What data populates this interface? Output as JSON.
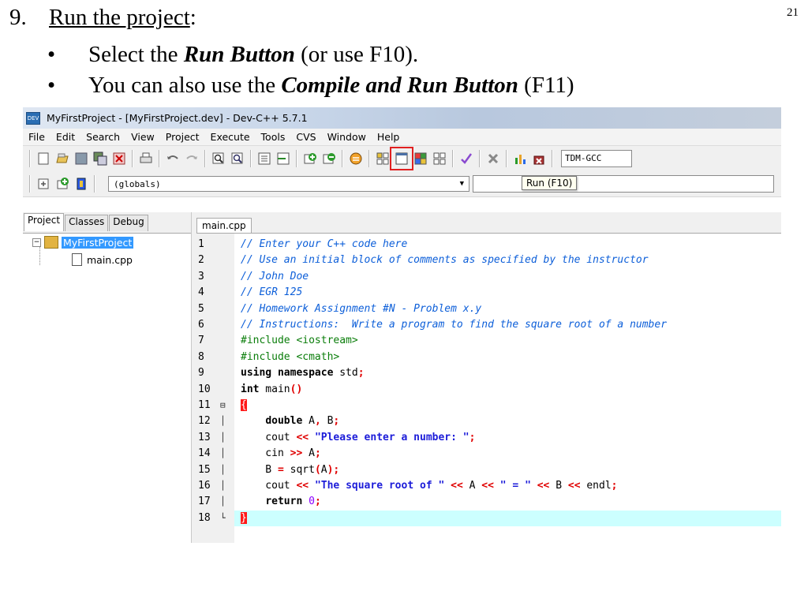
{
  "slide": {
    "number": "21",
    "step_number": "9.",
    "step_heading": "Run the project",
    "step_colon": ":",
    "bullets": [
      {
        "pre": "Select the ",
        "bold": "Run Button",
        "post": " (or use F10)."
      },
      {
        "pre": "You can also use the ",
        "bold": "Compile and Run Button",
        "post": " (F11)"
      }
    ]
  },
  "window": {
    "title": "MyFirstProject - [MyFirstProject.dev] - Dev-C++ 5.7.1",
    "menu": [
      "File",
      "Edit",
      "Search",
      "View",
      "Project",
      "Execute",
      "Tools",
      "CVS",
      "Window",
      "Help"
    ],
    "compiler": "TDM-GCC",
    "globals": "(globals)",
    "tooltip": "Run (F10)",
    "left_tabs": [
      "Project",
      "Classes",
      "Debug"
    ],
    "tree": {
      "project": "MyFirstProject",
      "file": "main.cpp"
    },
    "editor_tab": "main.cpp"
  },
  "code": [
    {
      "n": "1",
      "fold": "",
      "tokens": [
        [
          "cm",
          "// Enter your C++ code here"
        ]
      ]
    },
    {
      "n": "2",
      "fold": "",
      "tokens": [
        [
          "cm",
          "// Use an initial block of comments as specified by the instructor"
        ]
      ]
    },
    {
      "n": "3",
      "fold": "",
      "tokens": [
        [
          "cm",
          "// John Doe"
        ]
      ]
    },
    {
      "n": "4",
      "fold": "",
      "tokens": [
        [
          "cm",
          "// EGR 125"
        ]
      ]
    },
    {
      "n": "5",
      "fold": "",
      "tokens": [
        [
          "cm",
          "// Homework Assignment #N - Problem x.y"
        ]
      ]
    },
    {
      "n": "6",
      "fold": "",
      "tokens": [
        [
          "cm",
          "// Instructions:  Write a program to find the square root of a number"
        ]
      ]
    },
    {
      "n": "7",
      "fold": "",
      "tokens": [
        [
          "pp",
          "#include <iostream>"
        ]
      ]
    },
    {
      "n": "8",
      "fold": "",
      "tokens": [
        [
          "pp",
          "#include <cmath>"
        ]
      ]
    },
    {
      "n": "9",
      "fold": "",
      "tokens": [
        [
          "kw",
          "using namespace"
        ],
        [
          "",
          " std"
        ],
        [
          "sy",
          ";"
        ]
      ]
    },
    {
      "n": "10",
      "fold": "",
      "tokens": [
        [
          "kw",
          "int"
        ],
        [
          "",
          " main"
        ],
        [
          "sy",
          "()"
        ]
      ]
    },
    {
      "n": "11",
      "fold": "⊟",
      "tokens": [
        [
          "brace",
          "{"
        ]
      ]
    },
    {
      "n": "12",
      "fold": "│",
      "tokens": [
        [
          "",
          "    "
        ],
        [
          "kw",
          "double"
        ],
        [
          "",
          " A"
        ],
        [
          "sy",
          ","
        ],
        [
          "",
          " B"
        ],
        [
          "sy",
          ";"
        ]
      ]
    },
    {
      "n": "13",
      "fold": "│",
      "tokens": [
        [
          "",
          "    cout "
        ],
        [
          "sy",
          "<<"
        ],
        [
          "",
          " "
        ],
        [
          "st",
          "\"Please enter a number: \""
        ],
        [
          "sy",
          ";"
        ]
      ]
    },
    {
      "n": "14",
      "fold": "│",
      "tokens": [
        [
          "",
          "    cin "
        ],
        [
          "sy",
          ">>"
        ],
        [
          "",
          " A"
        ],
        [
          "sy",
          ";"
        ]
      ]
    },
    {
      "n": "15",
      "fold": "│",
      "tokens": [
        [
          "",
          "    B "
        ],
        [
          "sy",
          "="
        ],
        [
          "",
          " sqrt"
        ],
        [
          "sy",
          "("
        ],
        [
          "",
          "A"
        ],
        [
          "sy",
          ");"
        ]
      ]
    },
    {
      "n": "16",
      "fold": "│",
      "tokens": [
        [
          "",
          "    cout "
        ],
        [
          "sy",
          "<<"
        ],
        [
          "",
          " "
        ],
        [
          "st",
          "\"The square root of \""
        ],
        [
          "",
          " "
        ],
        [
          "sy",
          "<<"
        ],
        [
          "",
          " A "
        ],
        [
          "sy",
          "<<"
        ],
        [
          "",
          " "
        ],
        [
          "st",
          "\" = \""
        ],
        [
          "",
          " "
        ],
        [
          "sy",
          "<<"
        ],
        [
          "",
          " B "
        ],
        [
          "sy",
          "<<"
        ],
        [
          "",
          " endl"
        ],
        [
          "sy",
          ";"
        ]
      ]
    },
    {
      "n": "17",
      "fold": "│",
      "tokens": [
        [
          "",
          "    "
        ],
        [
          "kw",
          "return"
        ],
        [
          "",
          " "
        ],
        [
          "nm",
          "0"
        ],
        [
          "sy",
          ";"
        ]
      ]
    },
    {
      "n": "18",
      "fold": "└",
      "tokens": [
        [
          "brace",
          "}"
        ]
      ]
    }
  ]
}
